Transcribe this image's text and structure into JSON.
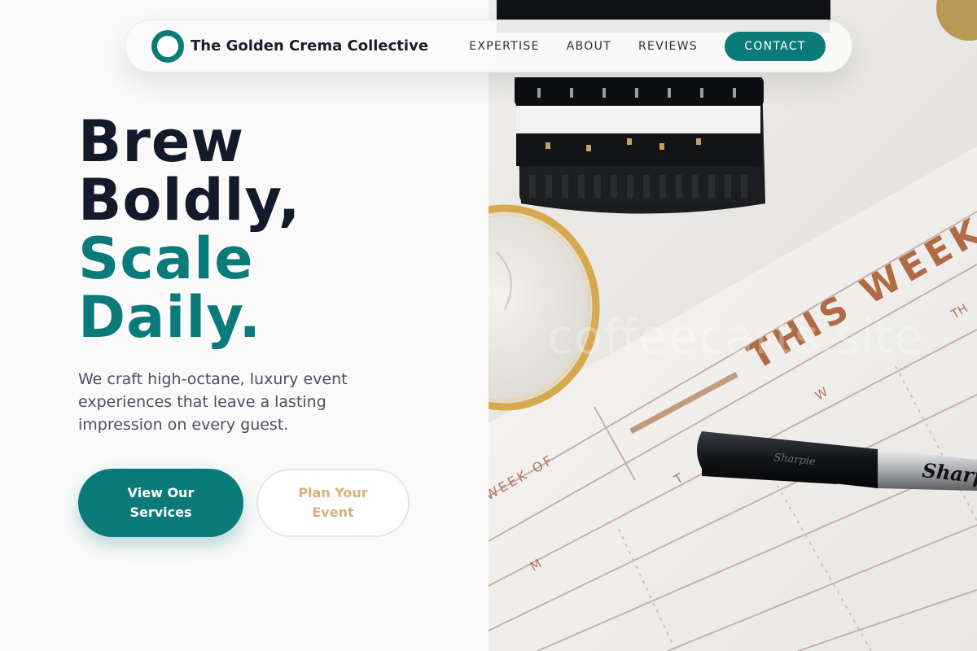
{
  "nav": {
    "brand": "The Golden Crema Collective",
    "links": [
      "EXPERTISE",
      "ABOUT",
      "REVIEWS"
    ],
    "cta": "CONTACT"
  },
  "hero": {
    "title_line1": "Brew",
    "title_line2": "Boldly,",
    "title_line3": "Scale",
    "title_line4": "Daily.",
    "subtitle": "We craft high-octane, luxury event experiences that leave a lasting impression on every guest.",
    "primary_button": "View Our Services",
    "secondary_button": "Plan Your Event"
  },
  "image": {
    "watermark": "coffeecarts.site",
    "planner_heading": "THIS WEEK",
    "planner_subheading": "WEEK OF",
    "weekday_letters": [
      "M",
      "T",
      "W",
      "TH"
    ],
    "marker_brand": "Sharpie",
    "marker_detail": "Sharpie"
  },
  "colors": {
    "accent": "#0b7b7a",
    "title_dark": "#131a2a",
    "secondary_button_text": "#d9b07e"
  }
}
